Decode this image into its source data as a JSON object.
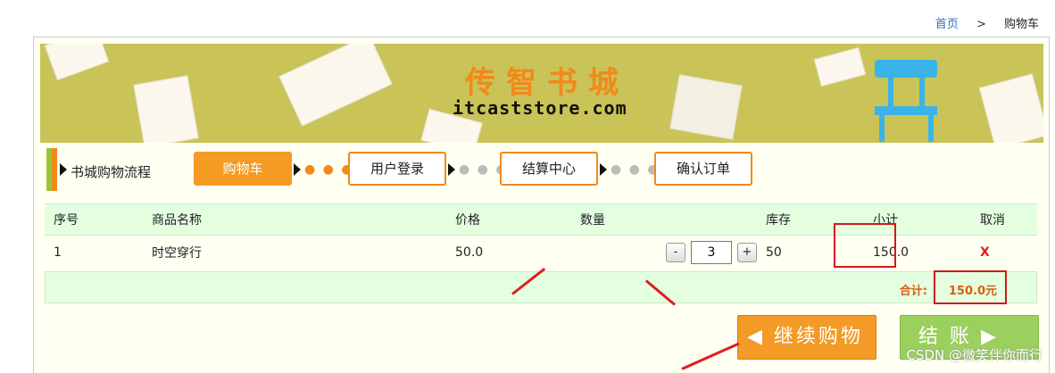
{
  "breadcrumb": {
    "home": "首页",
    "separator": ">",
    "current": "购物车"
  },
  "banner": {
    "title": "传智书城",
    "subtitle": "itcaststore.com"
  },
  "flow": {
    "label": "书城购物流程",
    "steps": [
      {
        "label": "购物车",
        "active": true
      },
      {
        "label": "用户登录",
        "active": false
      },
      {
        "label": "结算中心",
        "active": false
      },
      {
        "label": "确认订单",
        "active": false
      }
    ],
    "dots": "● ● ●"
  },
  "table": {
    "headers": [
      "序号",
      "商品名称",
      "价格",
      "数量",
      "库存",
      "小计",
      "取消"
    ],
    "rows": [
      {
        "index": "1",
        "name": "时空穿行",
        "price": "50.0",
        "quantity": "3",
        "stock": "50",
        "subtotal": "150.0",
        "cancel": "X"
      }
    ],
    "minus_label": "-",
    "plus_label": "+"
  },
  "total": {
    "label": "合计:",
    "value": "150.0元"
  },
  "buttons": {
    "continue": "◀ 继续购物",
    "checkout": "结  账 ▶"
  },
  "watermark": "CSDN @微笑伴你而行",
  "colors": {
    "accent": "#f08a1a",
    "table_header": "#e3ffe0",
    "highlight": "#d31818",
    "checkout": "#9bd05e"
  }
}
